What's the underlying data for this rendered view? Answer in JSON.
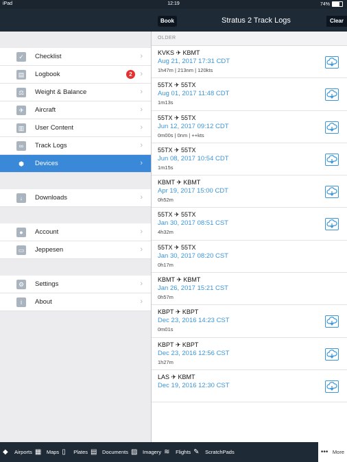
{
  "status": {
    "device": "iPad",
    "time": "12:19",
    "battery": "74%"
  },
  "nav": {
    "back_label": "Book",
    "title": "Stratus 2 Track Logs",
    "clear_label": "Clear"
  },
  "sidebar": {
    "group1": [
      {
        "label": "Checklist",
        "icon": "check-icon"
      },
      {
        "label": "Logbook",
        "icon": "book-icon",
        "badge": "2"
      },
      {
        "label": "Weight & Balance",
        "icon": "scale-icon"
      },
      {
        "label": "Aircraft",
        "icon": "airplane-icon"
      },
      {
        "label": "User Content",
        "icon": "document-icon"
      },
      {
        "label": "Track Logs",
        "icon": "track-icon"
      },
      {
        "label": "Devices",
        "icon": "device-icon",
        "active": true
      }
    ],
    "group2": [
      {
        "label": "Downloads",
        "icon": "download-icon"
      }
    ],
    "group3": [
      {
        "label": "Account",
        "icon": "person-icon"
      },
      {
        "label": "Jeppesen",
        "icon": "jeppesen-icon"
      }
    ],
    "group4": [
      {
        "label": "Settings",
        "icon": "gear-icon"
      },
      {
        "label": "About",
        "icon": "info-icon"
      }
    ]
  },
  "list": {
    "section_label": "OLDER",
    "logs": [
      {
        "route": "KVKS ✈ KBMT",
        "date": "Aug 21, 2017 17:31 CDT",
        "stats": "1h47m | 213nm | 120kts"
      },
      {
        "route": "55TX ✈ 55TX",
        "date": "Aug 01, 2017 11:48 CDT",
        "stats": "1m13s"
      },
      {
        "route": "55TX ✈ 55TX",
        "date": "Jun 12, 2017 09:12 CDT",
        "stats": "0m00s | 0nm | ++kts"
      },
      {
        "route": "55TX ✈ 55TX",
        "date": "Jun 08, 2017 10:54 CDT",
        "stats": "1m15s"
      },
      {
        "route": "KBMT ✈ KBMT",
        "date": "Apr 19, 2017 15:00 CDT",
        "stats": "0h52m"
      },
      {
        "route": "55TX ✈ 55TX",
        "date": "Jan 30, 2017 08:51 CST",
        "stats": "4h32m"
      },
      {
        "route": "55TX ✈ 55TX",
        "date": "Jan 30, 2017 08:20 CST",
        "stats": "0h17m"
      },
      {
        "route": "KBMT ✈ KBMT",
        "date": "Jan 26, 2017 15:21 CST",
        "stats": "0h57m"
      },
      {
        "route": "KBPT ✈ KBPT",
        "date": "Dec 23, 2016 14:23 CST",
        "stats": "0m01s"
      },
      {
        "route": "KBPT ✈ KBPT",
        "date": "Dec 23, 2016 12:56 CST",
        "stats": "1h27m"
      },
      {
        "route": "LAS ✈ KBMT",
        "date": "Dec 19, 2016 12:30 CST",
        "stats": ""
      }
    ]
  },
  "tabs": [
    {
      "label": "Airports",
      "icon": "airport-icon"
    },
    {
      "label": "Maps",
      "icon": "map-icon"
    },
    {
      "label": "Plates",
      "icon": "plates-icon"
    },
    {
      "label": "Documents",
      "icon": "documents-icon"
    },
    {
      "label": "Imagery",
      "icon": "imagery-icon"
    },
    {
      "label": "Flights",
      "icon": "flights-icon"
    },
    {
      "label": "ScratchPads",
      "icon": "pen-icon"
    },
    {
      "label": "More",
      "icon": "more-icon"
    }
  ],
  "colors": {
    "accent": "#3a88d8",
    "link": "#3a95d8",
    "navbar": "#1e2a36",
    "badge": "#e53030"
  }
}
